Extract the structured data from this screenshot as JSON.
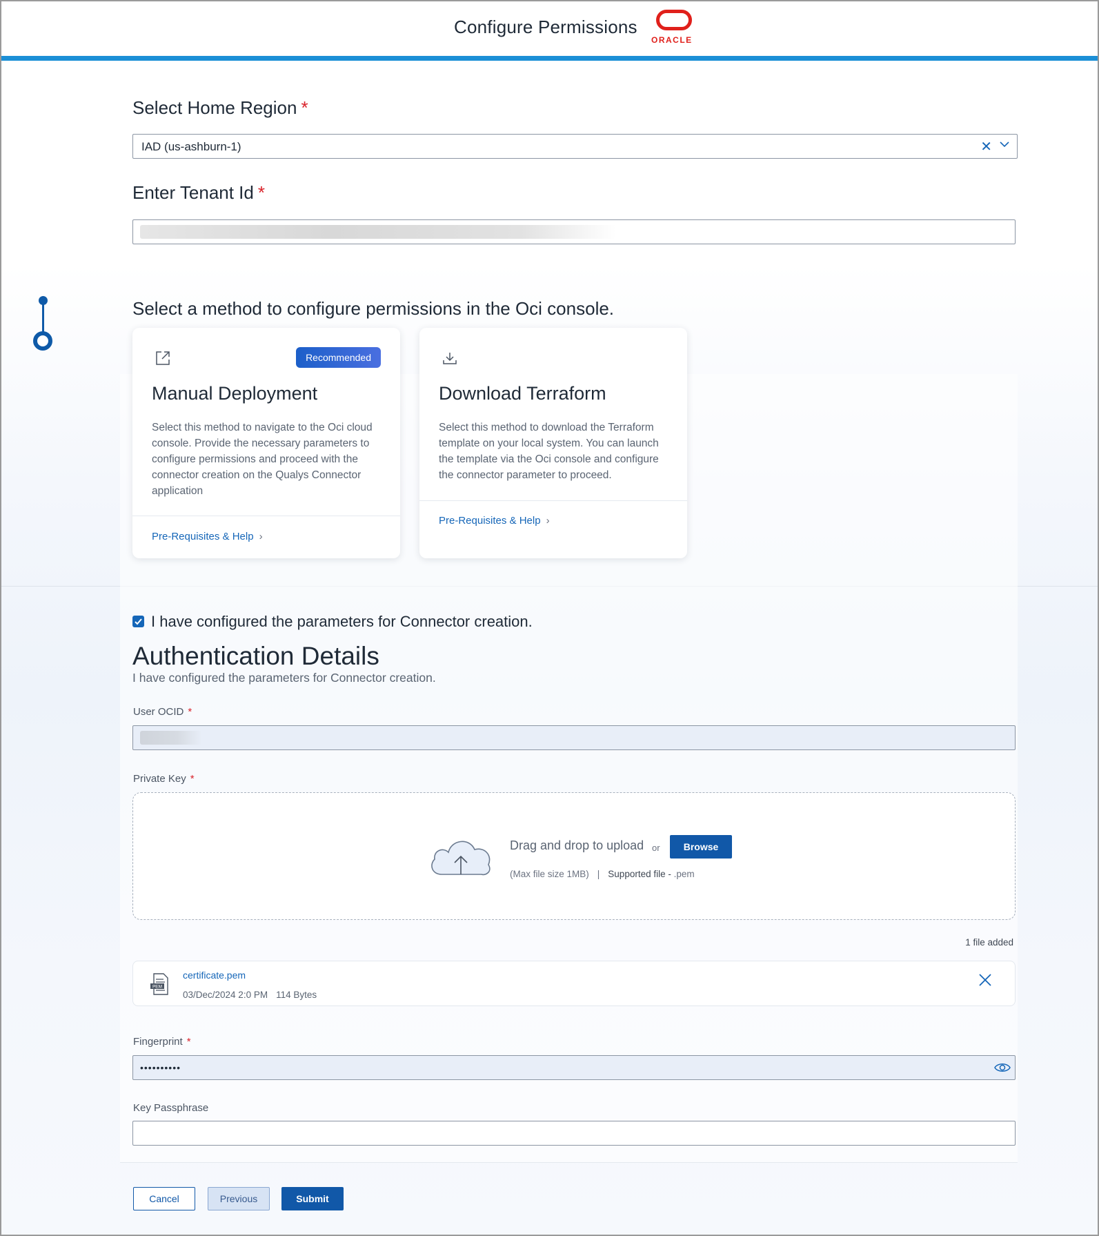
{
  "header": {
    "title": "Configure Permissions",
    "logo_text": "ORACLE",
    "accent_color": "#1b8fd6",
    "brand_color": "#e0201b"
  },
  "home_region": {
    "label": "Select Home Region",
    "required_mark": "*",
    "value": "IAD (us-ashburn-1)"
  },
  "tenant": {
    "label": "Enter Tenant Id",
    "required_mark": "*"
  },
  "method": {
    "title": "Select a method to configure permissions in the Oci console.",
    "cards": [
      {
        "icon": "external-link-icon",
        "badge": "Recommended",
        "title": "Manual Deployment",
        "description": "Select this method to navigate to the Oci cloud console. Provide the necessary parameters to configure permissions and proceed with the connector creation on the Qualys Connector application",
        "link": "Pre-Requisites & Help"
      },
      {
        "icon": "download-icon",
        "title": "Download Terraform",
        "description": "Select this method to download the Terraform template on your local system. You can launch the template via the Oci console and configure the connector parameter to proceed.",
        "link": "Pre-Requisites & Help"
      }
    ]
  },
  "confirm": {
    "label": "I have configured the parameters for Connector creation.",
    "checked": true
  },
  "auth": {
    "title": "Authentication Details",
    "subtitle": "I have configured the parameters for Connector creation.",
    "user_ocid_label": "User OCID",
    "private_key_label": "Private Key",
    "fingerprint_label": "Fingerprint",
    "passphrase_label": "Key Passphrase",
    "required_mark": "*",
    "fingerprint_masked": "••••••••••"
  },
  "upload": {
    "drag_text": "Drag and drop to upload",
    "or_text": "or",
    "browse_label": "Browse",
    "max_size": "(Max file size 1MB)",
    "separator": "|",
    "supported_label": "Supported file -",
    "supported_ext": ".pem",
    "files_added": "1 file added",
    "file": {
      "icon_text": "PEM",
      "name": "certificate.pem",
      "date": "03/Dec/2024 2:0 PM",
      "size": "114 Bytes"
    }
  },
  "footer": {
    "cancel": "Cancel",
    "previous": "Previous",
    "submit": "Submit"
  }
}
